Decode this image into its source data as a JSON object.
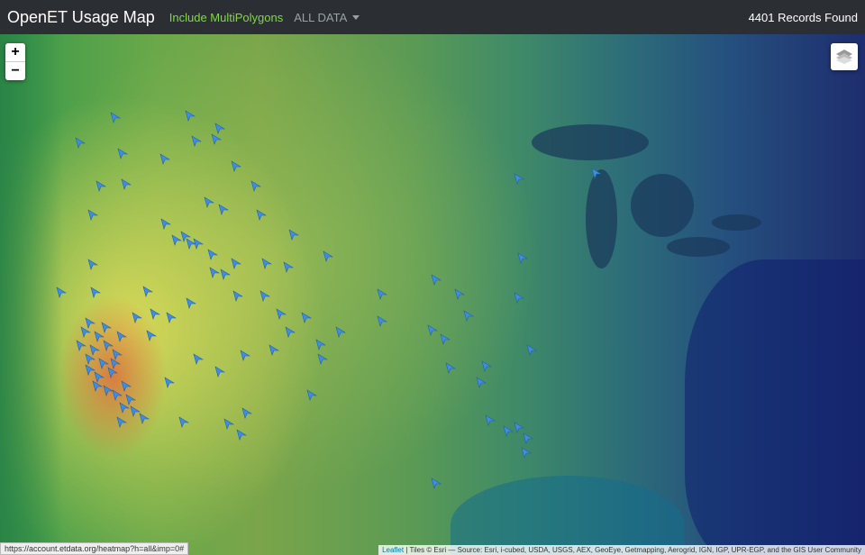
{
  "navbar": {
    "title": "OpenET Usage Map",
    "multipolygons_link": "Include MultiPolygons",
    "data_filter": "ALL DATA",
    "records": "4401 Records Found"
  },
  "map": {
    "zoom_in": "+",
    "zoom_out": "−",
    "layers_icon": "layers-icon"
  },
  "status_url": "https://account.etdata.org/heatmap?h=all&imp=0#",
  "attribution": {
    "leaflet": "Leaflet",
    "text": "| Tiles © Esri — Source: Esri, i-cubed, USDA, USGS, AEX, GeoEye, Getmapping, Aerogrid, IGN, IGP, UPR-EGP, and the GIS User Community"
  },
  "colors": {
    "navbar_bg": "#2b2f33",
    "accent_green": "#7ddc3c",
    "marker_blue": "#3d8fe6"
  }
}
